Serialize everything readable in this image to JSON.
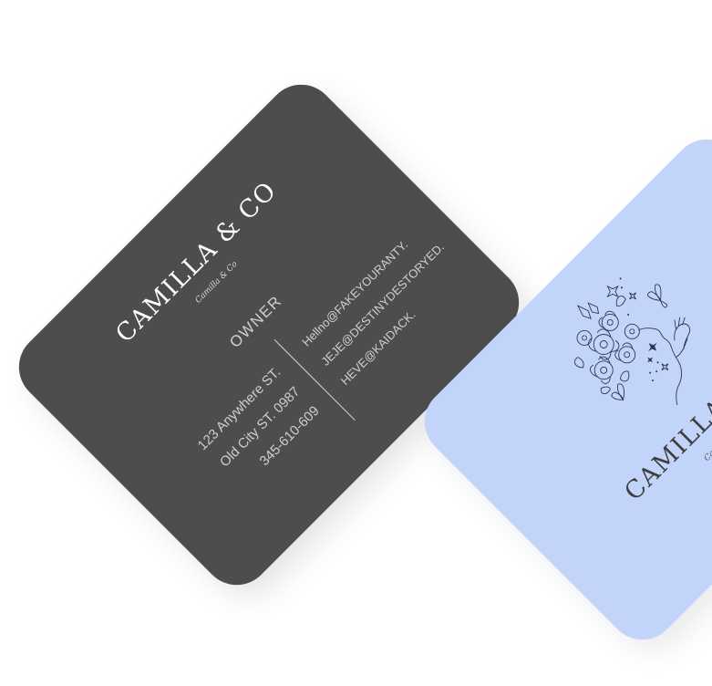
{
  "dark_card": {
    "brand": "CAMILLA & CO",
    "signature": "Camilla & Co",
    "role": "OWNER",
    "address": [
      "123 Anywhere ST.",
      "Old City ST. 0987",
      "345-610-609"
    ],
    "emails": [
      "Hellno@FAKEYOURANTY.",
      "JEJE@DESTINYDESTORYED.",
      "HEVE@KAIDACK."
    ]
  },
  "blue_card": {
    "brand": "CAMILLA & CO",
    "signature": "Camilla & Co",
    "illustration": "woman-with-flowers-and-butterflies-icon"
  },
  "colors": {
    "dark_card": "#4d4d4d",
    "blue_card": "#c3d4fb",
    "background": "#ffffff"
  }
}
